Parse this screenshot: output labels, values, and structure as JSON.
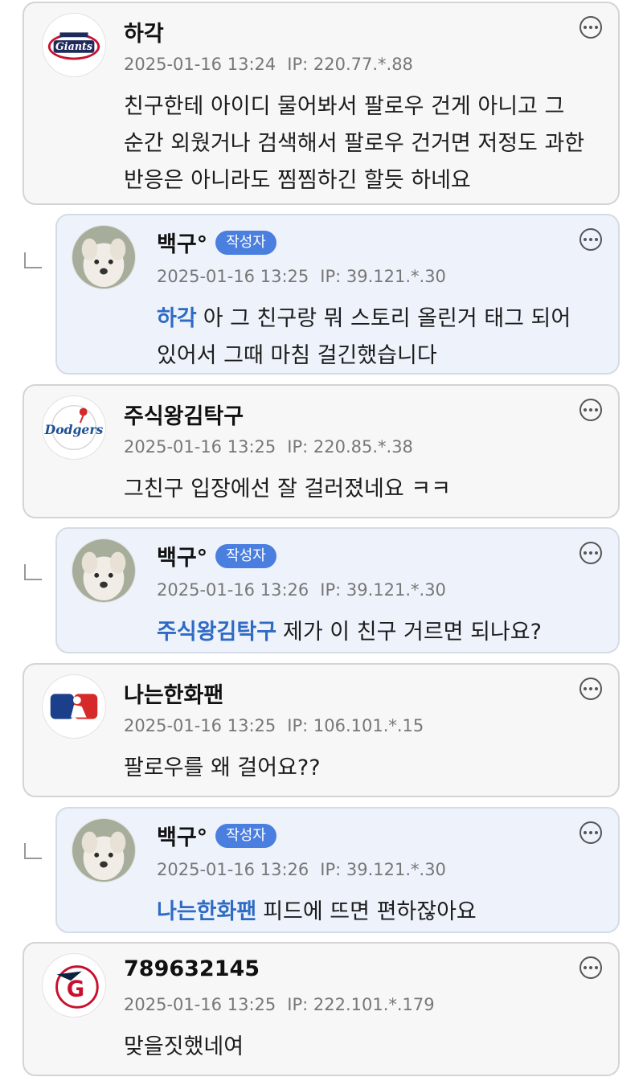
{
  "comments": [
    {
      "nick": "하각",
      "date": "2025-01-16 13:24",
      "ip": "IP: 220.77.*.88",
      "text": "친구한테 아이디 물어봐서 팔로우 건게 아니고 그 순간 외웠거나 검색해서 팔로우 건거면 저정도 과한 반응은 아니라도 찜찜하긴 할듯 하네요",
      "avatar_icon": "giants-logo-icon"
    },
    {
      "nick": "백구°",
      "badge": "작성자",
      "date": "2025-01-16 13:25",
      "ip": "IP: 39.121.*.30",
      "mention": "하각",
      "text": "아 그 친구랑 뭐 스토리 올린거 태그 되어있어서 그때 마침 걸긴했습니다",
      "avatar_icon": "dog-avatar-icon"
    },
    {
      "nick": "주식왕김탁구",
      "date": "2025-01-16 13:25",
      "ip": "IP: 220.85.*.38",
      "text": "그친구 입장에선 잘 걸러졌네요 ㅋㅋ",
      "avatar_icon": "dodgers-logo-icon"
    },
    {
      "nick": "백구°",
      "badge": "작성자",
      "date": "2025-01-16 13:26",
      "ip": "IP: 39.121.*.30",
      "mention": "주식왕김탁구",
      "text": "제가 이 친구 거르면 되나요?",
      "avatar_icon": "dog-avatar-icon"
    },
    {
      "nick": "나는한화팬",
      "date": "2025-01-16 13:25",
      "ip": "IP: 106.101.*.15",
      "text": "팔로우를 왜 걸어요??",
      "avatar_icon": "mlb-logo-icon"
    },
    {
      "nick": "백구°",
      "badge": "작성자",
      "date": "2025-01-16 13:26",
      "ip": "IP: 39.121.*.30",
      "mention": "나는한화팬",
      "text": "피드에 뜨면 편하잖아요",
      "avatar_icon": "dog-avatar-icon"
    },
    {
      "nick": "789632145",
      "date": "2025-01-16 13:25",
      "ip": "IP: 222.101.*.179",
      "text": "맞을짓했네여",
      "avatar_icon": "guardians-logo-icon"
    }
  ],
  "colors": {
    "mention": "#2f6bc4",
    "badge": "#4a7fe0",
    "reply_bg": "#eef3fb",
    "comment_bg": "#f7f7f7"
  },
  "more_icon": "comment-more-icon"
}
